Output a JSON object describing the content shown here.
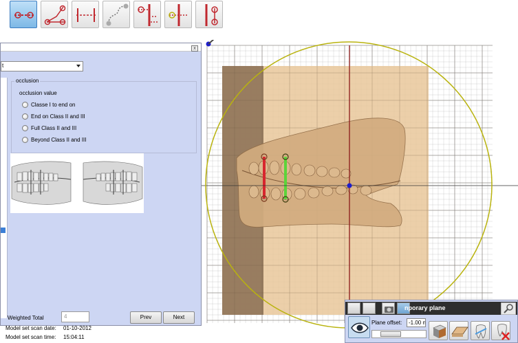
{
  "toolbar": {
    "tools": [
      {
        "icon": "line-tool-icon",
        "active": true
      },
      {
        "icon": "angle-tool-icon",
        "active": false
      },
      {
        "icon": "distance-tool-icon",
        "active": false
      },
      {
        "icon": "curve-tool-icon",
        "active": false
      },
      {
        "icon": "point-line-tool-icon",
        "active": false
      },
      {
        "icon": "vertical-line-tool-icon",
        "active": false
      },
      {
        "icon": "parallel-line-tool-icon",
        "active": false
      }
    ],
    "colors": {
      "active_bg": "#9ccbef",
      "icon_red": "#c0282f"
    }
  },
  "dialog": {
    "combo_value": "t",
    "close_glyph": "x",
    "group_title": "occlusion",
    "subgroup_title": "occlusion value",
    "options": [
      "Classe I to end on",
      "End on Class II and III",
      "Full Class II and III",
      "Beyond Class II and III"
    ],
    "weighted_total_label": "Weighted Total",
    "weighted_total_value": "4",
    "prev_label": "Prev",
    "next_label": "Next"
  },
  "info": {
    "scan_date_label": "Model set scan date:",
    "scan_date_value": "01-10-2012",
    "scan_time_label": "Model set scan time:",
    "scan_time_value": "15:04:11"
  },
  "plane_panel": {
    "title": "nporary plane",
    "offset_label": "Plane offset:",
    "offset_value": "-1.00 n"
  },
  "viewport": {
    "colors": {
      "grid": "#9e9e9e",
      "circle": "#b9b30e",
      "model": "#d2ac7f",
      "plane_dark": "#7c6248",
      "red_line": "#d8262e",
      "green_line": "#5cd43a",
      "center_point": "#1d1dcc"
    }
  }
}
